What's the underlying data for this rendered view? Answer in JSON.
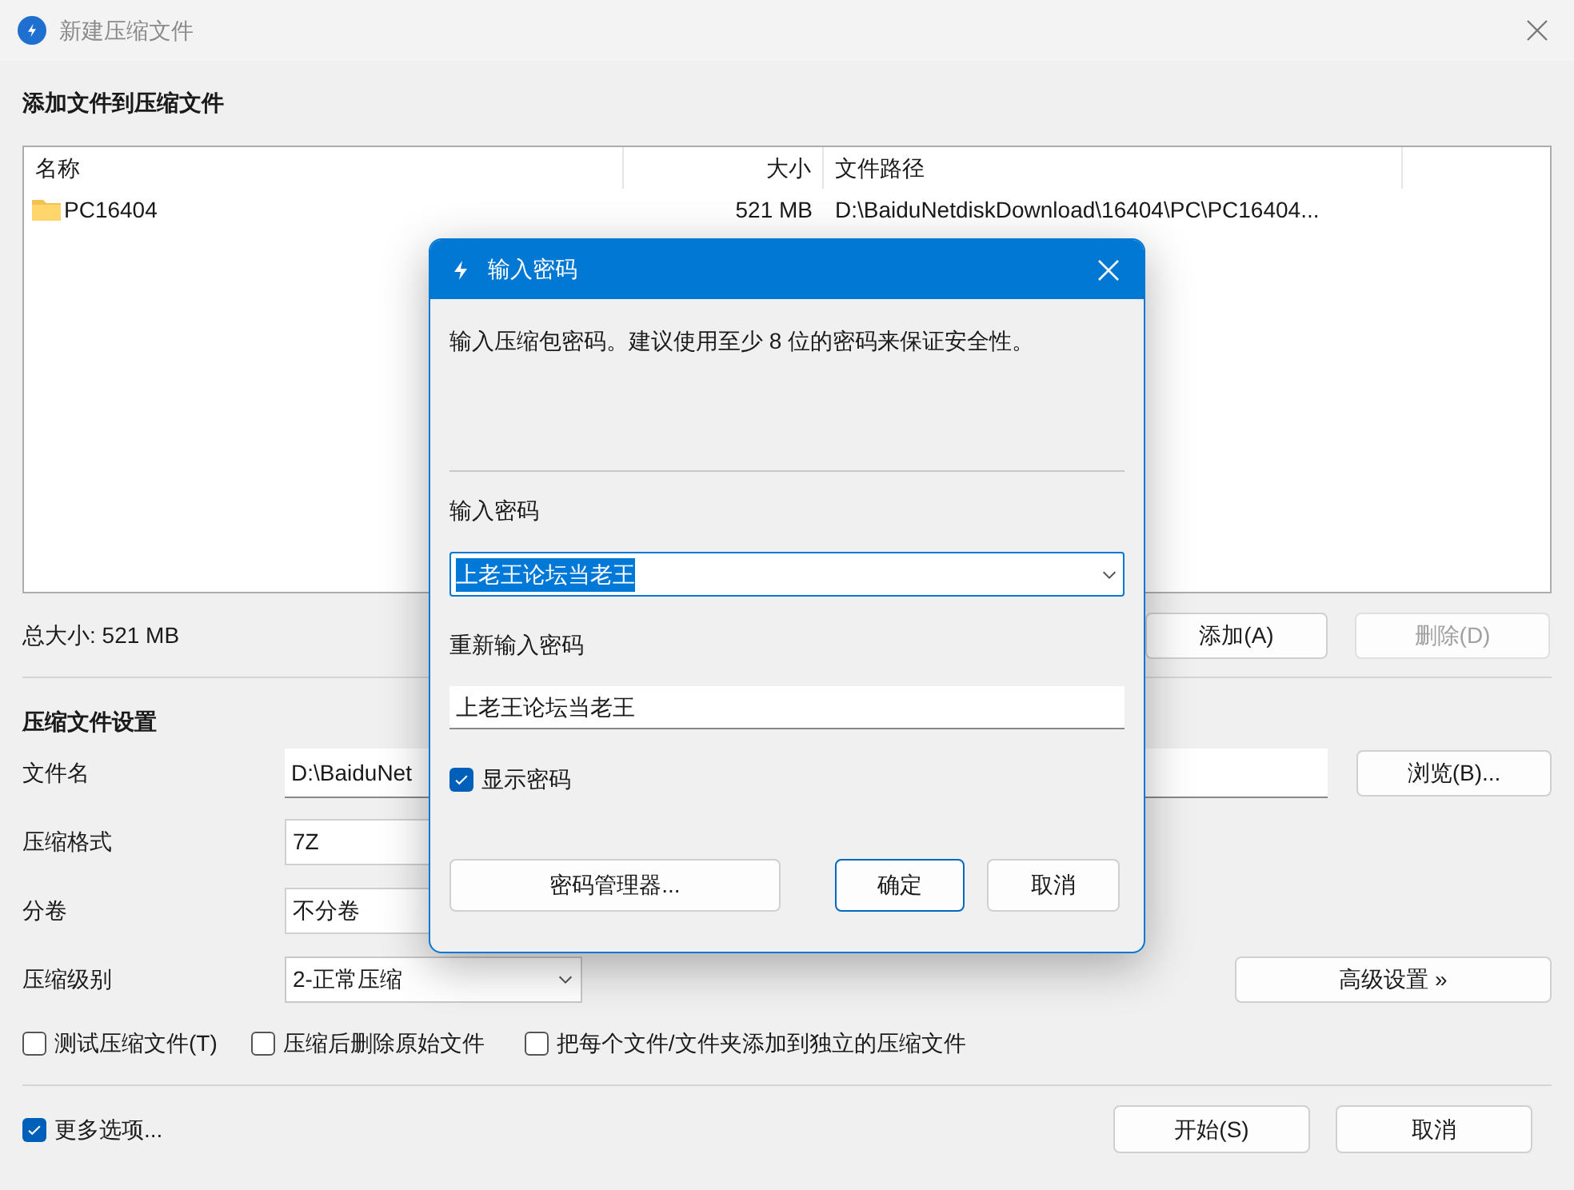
{
  "window": {
    "title": "新建压缩文件"
  },
  "files_section": {
    "heading": "添加文件到压缩文件"
  },
  "file_table": {
    "columns": [
      "名称",
      "大小",
      "文件路径"
    ],
    "rows": [
      {
        "name": "PC16404",
        "size": "521 MB",
        "path": "D:\\BaiduNetdiskDownload\\16404\\PC\\PC16404..."
      }
    ]
  },
  "total_size": "总大小: 521 MB",
  "file_buttons": [
    {
      "label": "添加(A)",
      "disabled": false
    },
    {
      "label": "删除(D)",
      "disabled": true
    }
  ],
  "settings": {
    "heading": "压缩文件设置",
    "rows": [
      {
        "label": "文件名",
        "value": "D:\\BaiduNet",
        "kind": "text",
        "button": "浏览(B)..."
      },
      {
        "label": "压缩格式",
        "value": "7Z",
        "kind": "combo"
      },
      {
        "label": "分卷",
        "value": "不分卷",
        "kind": "combo"
      },
      {
        "label": "压缩级别",
        "value": "2-正常压缩",
        "kind": "select",
        "button": "高级设置 »"
      }
    ]
  },
  "options": [
    {
      "label": "测试压缩文件(T)",
      "checked": false
    },
    {
      "label": "压缩后删除原始文件",
      "checked": false
    },
    {
      "label": "把每个文件/文件夹添加到独立的压缩文件",
      "checked": false
    }
  ],
  "more_options": {
    "label": "更多选项...",
    "checked": true
  },
  "footer_buttons": [
    {
      "label": "开始(S)"
    },
    {
      "label": "取消"
    }
  ],
  "dialog": {
    "title": "输入密码",
    "description": "输入压缩包密码。建议使用至少 8 位的密码来保证安全性。",
    "password_label": "输入密码",
    "password": "上老王论坛当老王",
    "password_selected": true,
    "confirm_label": "重新输入密码",
    "confirm": "上老王论坛当老王",
    "show_password": {
      "label": "显示密码",
      "checked": true
    },
    "buttons": [
      {
        "label": "密码管理器...",
        "default": false
      },
      {
        "label": "确定",
        "default": true
      },
      {
        "label": "取消",
        "default": false
      }
    ]
  }
}
